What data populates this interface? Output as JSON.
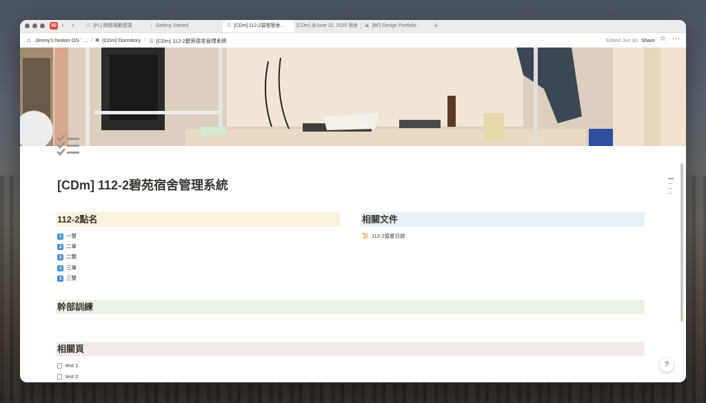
{
  "browser": {
    "app_badge": "",
    "tabs": [
      {
        "label": "[PL] 時間規劃建議",
        "icon": "checklist-icon"
      },
      {
        "label": "Getting Started",
        "icon": ""
      },
      {
        "label": "[CDm] 112-2碧苑宿舍…",
        "icon": "checklist-icon",
        "active": true
      },
      {
        "label": "[CDm] @June 22, 2025 宿舍",
        "icon": ""
      },
      {
        "label": "[BF] Design Portfolio",
        "icon": "page-icon"
      }
    ],
    "new_tab": "+"
  },
  "breadcrumb": {
    "items": [
      "Jimmy's Notion OS",
      "...",
      "[CDm] Dormitory",
      "[CDm] 112-2碧苑宿舍管理系統"
    ]
  },
  "toolbar": {
    "edited": "Edited Jun 30",
    "share": "Share",
    "favorite": "☆",
    "more": "···"
  },
  "page": {
    "title": "[CDm] 112-2碧苑宿舍管理系統",
    "sections": {
      "roll_call": {
        "heading": "112-2點名",
        "items": [
          {
            "badge": "1",
            "label": "一雙"
          },
          {
            "badge": "2",
            "label": "二單"
          },
          {
            "badge": "2",
            "label": "二雙"
          },
          {
            "badge": "3",
            "label": "三單"
          },
          {
            "badge": "3",
            "label": "三雙"
          }
        ]
      },
      "related_docs": {
        "heading": "相關文件",
        "items": [
          {
            "label": "112-2值星日誌"
          }
        ]
      },
      "training": {
        "heading": "幹部訓練"
      },
      "related_pages": {
        "heading": "相關頁",
        "items": [
          {
            "label": "test 1"
          },
          {
            "label": "test 2"
          }
        ]
      }
    }
  },
  "help_button": "?"
}
